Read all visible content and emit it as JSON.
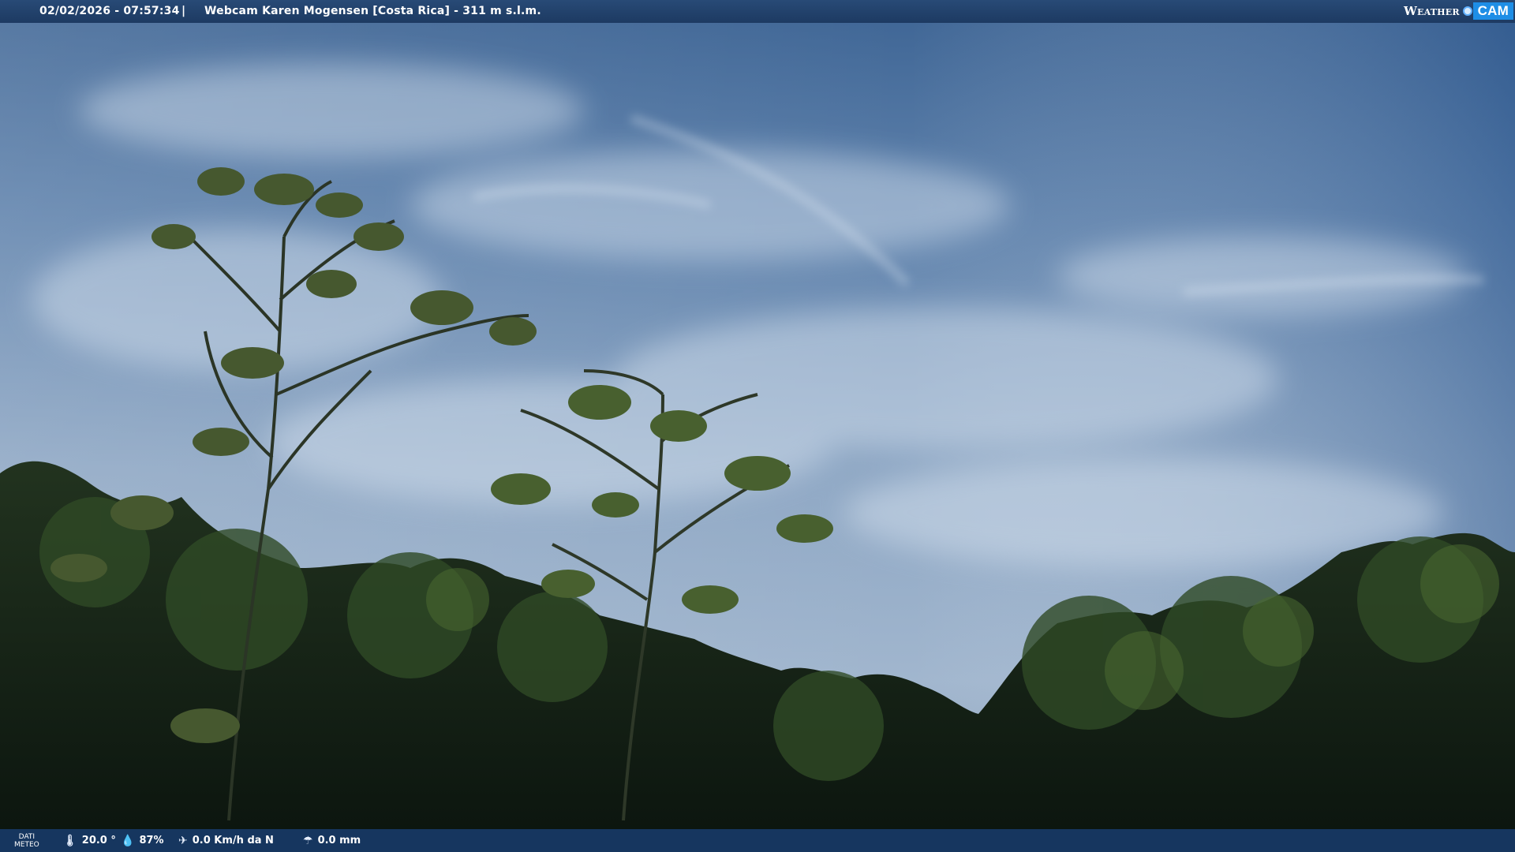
{
  "header": {
    "datetime": "02/02/2026 - 07:57:34",
    "separator": "|",
    "title": "Webcam Karen Mogensen [Costa Rica]  - 311 m s.l.m."
  },
  "brand": {
    "word": "Weather",
    "cam": "CAM"
  },
  "footer": {
    "meteo_label_line1": "DATI",
    "meteo_label_line2": "METEO",
    "temperature": "20.0 °",
    "humidity": "87%",
    "wind": "0.0 Km/h da N",
    "rain": "0.0 mm"
  },
  "colors": {
    "sky_top": "#3f6a9b",
    "sky_mid": "#8aa4c2",
    "sky_low": "#9fb4cc",
    "forest_dark": "#0f1c14",
    "foliage": "#3d5a2a",
    "bar": "#1e3d66",
    "accent": "#1e8ee6"
  },
  "icons": {
    "temperature": "thermometer-icon",
    "humidity": "droplet-icon",
    "wind": "wind-icon",
    "rain": "umbrella-icon",
    "brand": "weathercam-logo"
  }
}
